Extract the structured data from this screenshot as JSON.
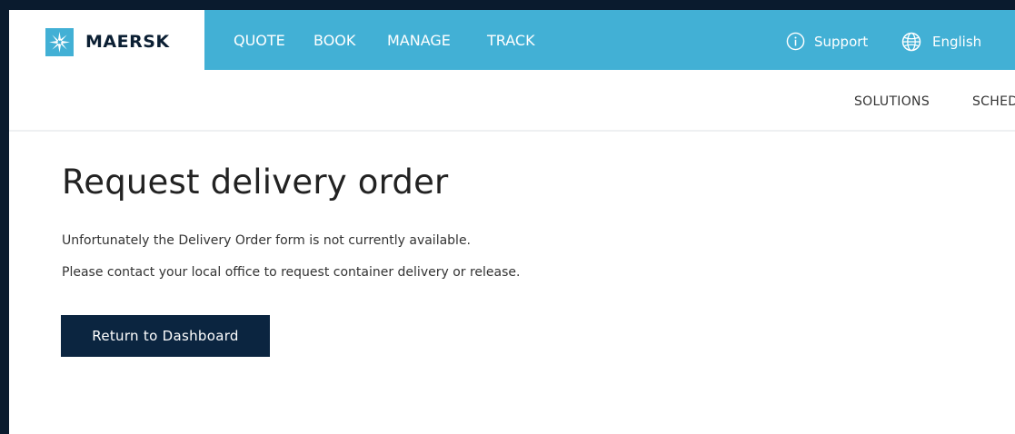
{
  "brand": {
    "name": "MAERSK",
    "logo_icon": "star-icon",
    "accent": "#42b0d5",
    "dark": "#0b2540"
  },
  "nav": {
    "items": [
      {
        "label": "QUOTE"
      },
      {
        "label": "BOOK"
      },
      {
        "label": "MANAGE"
      },
      {
        "label": "TRACK"
      }
    ],
    "support": {
      "label": "Support",
      "icon": "info-icon"
    },
    "language": {
      "label": "English",
      "icon": "globe-icon"
    }
  },
  "subnav": {
    "items": [
      {
        "label": "SOLUTIONS"
      },
      {
        "label": "SCHED"
      }
    ]
  },
  "main": {
    "title": "Request delivery order",
    "message_line1": "Unfortunately the Delivery Order form is not currently available.",
    "message_line2": "Please contact your local office to request container delivery or release.",
    "return_button": "Return to Dashboard"
  }
}
